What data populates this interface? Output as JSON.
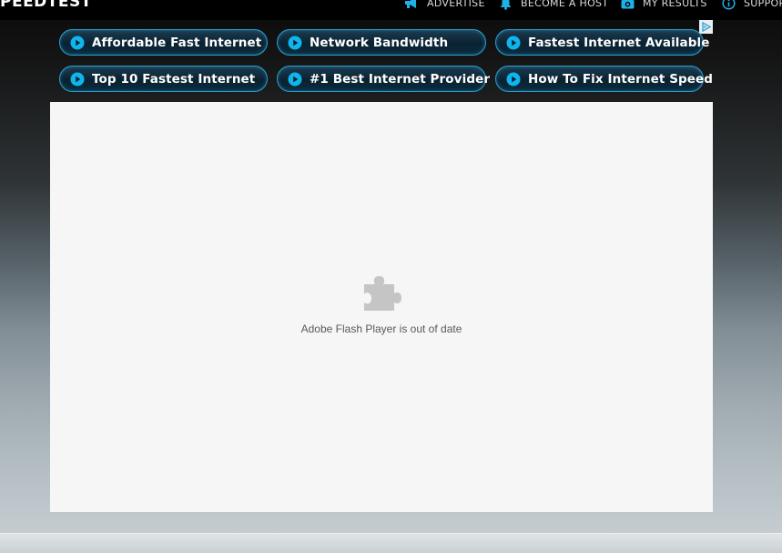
{
  "header": {
    "logo_text": "PEEDTEST",
    "nav": [
      {
        "label": "ADVERTISE",
        "icon": "megaphone-icon"
      },
      {
        "label": "BECOME A HOST",
        "icon": "bell-icon"
      },
      {
        "label": "MY RESULTS",
        "icon": "camera-icon"
      },
      {
        "label": "SUPPOR",
        "icon": "info-icon"
      }
    ]
  },
  "ads": {
    "links": [
      {
        "label": "Affordable Fast Internet"
      },
      {
        "label": "Network Bandwidth"
      },
      {
        "label": "Fastest Internet Available"
      },
      {
        "label": "Top 10 Fastest Internet"
      },
      {
        "label": "#1 Best Internet Provider"
      },
      {
        "label": "How To Fix Internet Speed"
      }
    ],
    "adchoices_icon": "adchoices-icon"
  },
  "plugin": {
    "icon": "puzzle-piece-icon",
    "message": "Adobe Flash Player is out of date"
  },
  "colors": {
    "accent": "#0fb6ee",
    "button_border": "#2b9fcf",
    "panel_bg": "#f6f6f6",
    "nav_icon": "#1fb0e6"
  }
}
